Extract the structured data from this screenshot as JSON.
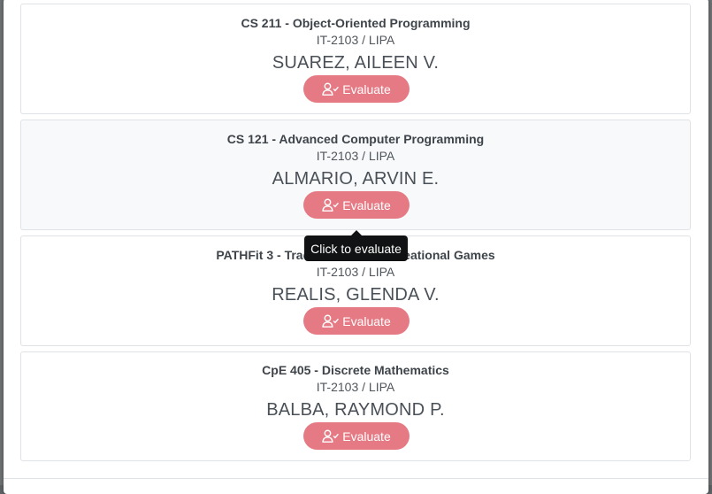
{
  "cards": [
    {
      "course": "CS 211 - Object-Oriented Programming",
      "section": "IT-2103 / LIPA",
      "teacher": "SUAREZ, AILEEN V.",
      "button": "Evaluate"
    },
    {
      "course": "CS 121 - Advanced Computer Programming",
      "section": "IT-2103 / LIPA",
      "teacher": "ALMARIO, ARVIN E.",
      "button": "Evaluate"
    },
    {
      "course": "PATHFit 3 - Traditional and Recreational Games",
      "section": "IT-2103 / LIPA",
      "teacher": "REALIS, GLENDA V.",
      "button": "Evaluate"
    },
    {
      "course": "CpE 405 - Discrete Mathematics",
      "section": "IT-2103 / LIPA",
      "teacher": "BALBA, RAYMOND P.",
      "button": "Evaluate"
    }
  ],
  "tooltip": "Click to evaluate",
  "colors": {
    "button": "#e57a84",
    "tooltip": "#111213"
  },
  "icons": {
    "evaluate": "user-check-icon"
  }
}
